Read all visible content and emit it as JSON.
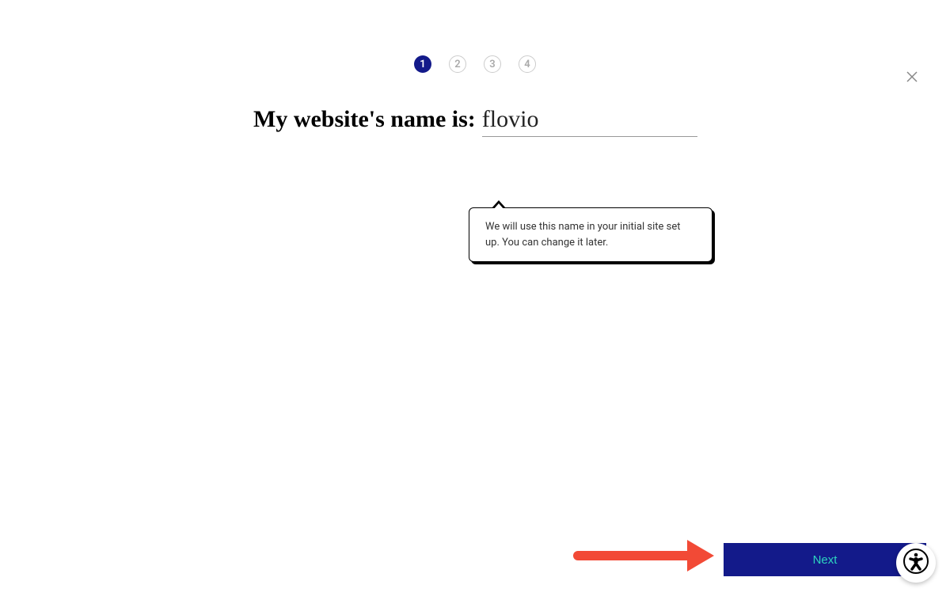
{
  "close_icon_name": "close",
  "stepper": {
    "steps": [
      "1",
      "2",
      "3",
      "4"
    ],
    "current": 1
  },
  "form": {
    "prompt": "My website's name is:",
    "value": "flovio"
  },
  "tooltip": {
    "text": "We will use this name in your initial site set up. You can change it later."
  },
  "buttons": {
    "next": "Next"
  }
}
